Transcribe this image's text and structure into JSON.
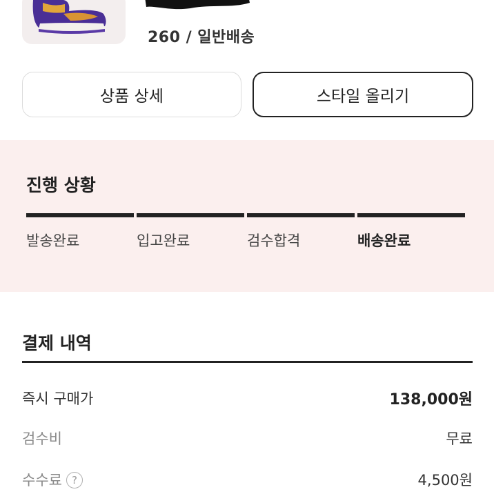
{
  "product": {
    "option_text": "260 / 일반배송"
  },
  "actions": {
    "detail_label": "상품 상세",
    "style_label": "스타일 올리기"
  },
  "progress": {
    "title": "진행 상황",
    "steps": [
      "발송완료",
      "입고완료",
      "검수합격",
      "배송완료"
    ],
    "current_step": "배송완료"
  },
  "payment": {
    "title": "결제 내역",
    "rows": [
      {
        "label": "즉시 구매가",
        "value": "138,000원"
      },
      {
        "label": "검수비",
        "value": "무료"
      },
      {
        "label": "수수료",
        "value": "4,500원"
      }
    ]
  },
  "colors": {
    "progress_bg": "#fbefee",
    "text_dark": "#222222",
    "muted": "#8a8a8a"
  },
  "icons": {
    "help": "question-circle-icon"
  }
}
